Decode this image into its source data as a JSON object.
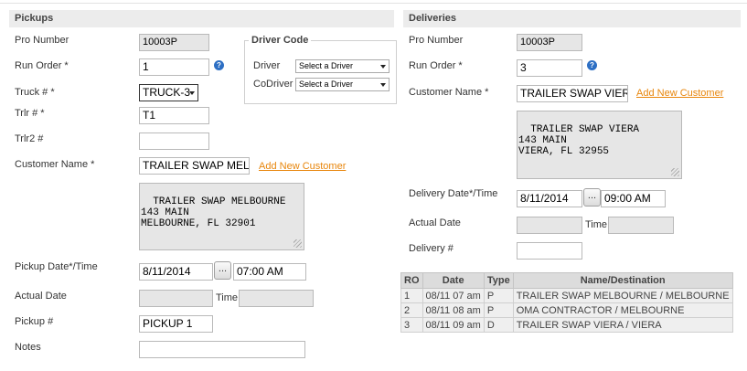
{
  "pickups": {
    "header": "Pickups",
    "pro_number_label": "Pro Number",
    "pro_number": "10003P",
    "run_order_label": "Run Order *",
    "run_order": "1",
    "truck_label": "Truck # *",
    "truck": "TRUCK-3",
    "trlr_label": "Trlr # *",
    "trlr": "T1",
    "trlr2_label": "Trlr2 #",
    "trlr2": "",
    "customer_name_label": "Customer Name *",
    "customer_name": "TRAILER SWAP MELBOURNE",
    "add_customer": "Add New Customer",
    "address": "TRAILER SWAP MELBOURNE\n143 MAIN\nMELBOURNE, FL 32901",
    "pickup_datetime_label": "Pickup Date*/Time",
    "pickup_date": "8/11/2014",
    "date_button": "...",
    "pickup_time": "07:00 AM",
    "actual_date_label": "Actual Date",
    "actual_date": "",
    "time_label": "Time",
    "actual_time": "",
    "pickup_no_label": "Pickup #",
    "pickup_no": "PICKUP 1",
    "notes_label": "Notes",
    "notes": ""
  },
  "driver_code": {
    "legend": "Driver Code",
    "driver_label": "Driver",
    "driver_select": "Select a Driver",
    "codriver_label": "CoDriver",
    "codriver_select": "Select a Driver"
  },
  "deliveries": {
    "header": "Deliveries",
    "pro_number_label": "Pro Number",
    "pro_number": "10003P",
    "run_order_label": "Run Order *",
    "run_order": "3",
    "customer_name_label": "Customer Name *",
    "customer_name": "TRAILER SWAP VIERA",
    "add_customer": "Add New Customer",
    "address": "TRAILER SWAP VIERA\n143 MAIN\nVIERA, FL 32955",
    "delivery_datetime_label": "Delivery Date*/Time",
    "delivery_date": "8/11/2014",
    "date_button": "...",
    "delivery_time": "09:00 AM",
    "actual_date_label": "Actual Date",
    "actual_date": "",
    "time_label": "Time",
    "actual_time": "",
    "delivery_no_label": "Delivery #",
    "delivery_no": ""
  },
  "stops_table": {
    "columns": [
      "RO",
      "Date",
      "Type",
      "Name/Destination"
    ],
    "rows": [
      [
        "1",
        "08/11 07 am",
        "P",
        "TRAILER SWAP MELBOURNE / MELBOURNE"
      ],
      [
        "2",
        "08/11 08 am",
        "P",
        "OMA CONTRACTOR / MELBOURNE"
      ],
      [
        "3",
        "08/11 09 am",
        "D",
        "TRAILER SWAP VIERA / VIERA"
      ]
    ]
  },
  "colors": {
    "link": "#e8860c",
    "help_icon": "#2d6fc4",
    "header_bg": "#ececec"
  }
}
